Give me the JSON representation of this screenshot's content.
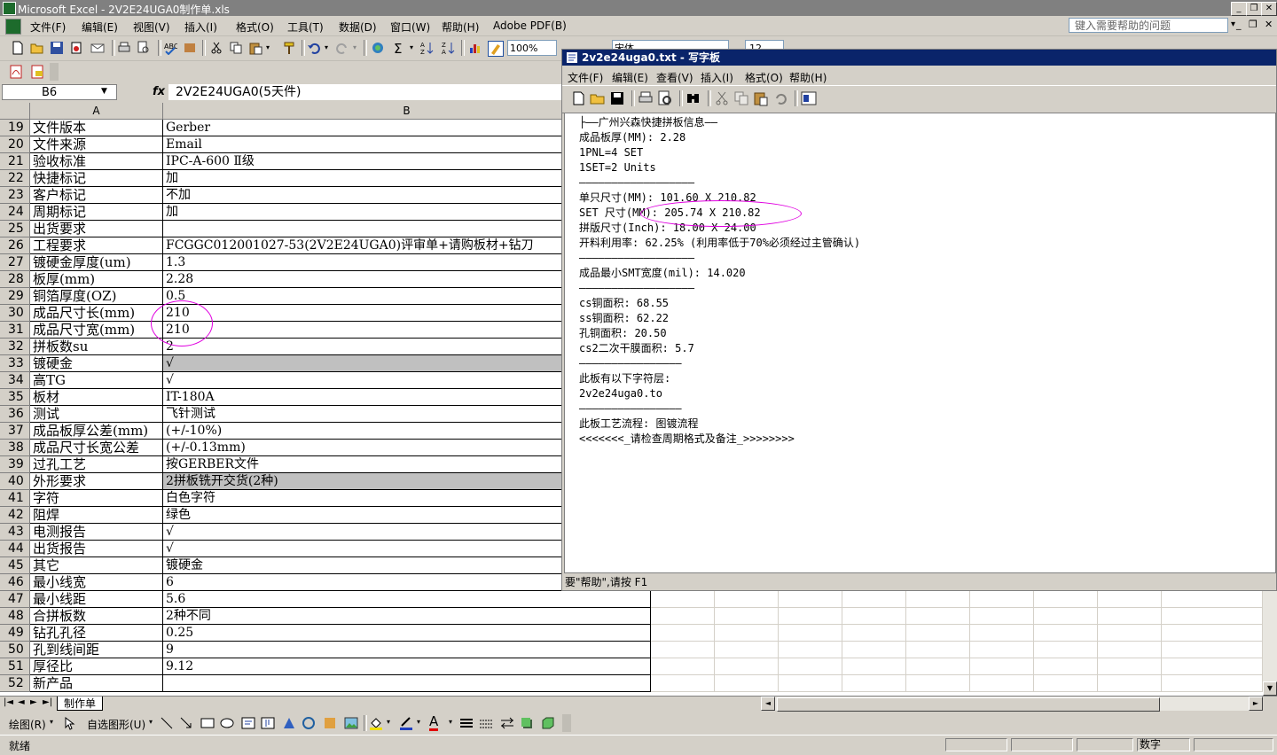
{
  "excel": {
    "title": "Microsoft Excel - 2V2E24UGA0制作单.xls",
    "menu": [
      "文件(F)",
      "编辑(E)",
      "视图(V)",
      "插入(I)",
      "格式(O)",
      "工具(T)",
      "数据(D)",
      "窗口(W)",
      "帮助(H)",
      "Adobe PDF(B)"
    ],
    "help_placeholder": "键入需要帮助的问题",
    "zoom": "100%",
    "font_name": "宋体",
    "font_size": "12",
    "name_box": "B6",
    "fx": "fx",
    "formula": "2V2E24UGA0(5天件)",
    "col_a": "A",
    "col_b": "B",
    "rows": [
      {
        "n": "19",
        "a": "文件版本",
        "b": "Gerber"
      },
      {
        "n": "20",
        "a": "文件来源",
        "b": "Email"
      },
      {
        "n": "21",
        "a": "验收标准",
        "b": "IPC-A-600 Ⅱ级"
      },
      {
        "n": "22",
        "a": "快捷标记",
        "b": "加"
      },
      {
        "n": "23",
        "a": "客户标记",
        "b": "不加"
      },
      {
        "n": "24",
        "a": "周期标记",
        "b": "加"
      },
      {
        "n": "25",
        "a": "出货要求",
        "b": ""
      },
      {
        "n": "26",
        "a": "工程要求",
        "b": "FCGGC012001027-53(2V2E24UGA0)评审单+请购板材+钻刀"
      },
      {
        "n": "27",
        "a": "镀硬金厚度(um)",
        "b": "1.3"
      },
      {
        "n": "28",
        "a": "板厚(mm)",
        "b": "2.28"
      },
      {
        "n": "29",
        "a": "铜箔厚度(OZ)",
        "b": "0.5"
      },
      {
        "n": "30",
        "a": "成品尺寸长(mm)",
        "b": "210"
      },
      {
        "n": "31",
        "a": "成品尺寸宽(mm)",
        "b": "210"
      },
      {
        "n": "32",
        "a": "拼板数su",
        "b": "2"
      },
      {
        "n": "33",
        "a": "镀硬金",
        "b": "√"
      },
      {
        "n": "34",
        "a": "高TG",
        "b": "√"
      },
      {
        "n": "35",
        "a": "板材",
        "b": "IT-180A"
      },
      {
        "n": "36",
        "a": "测试",
        "b": "飞针测试"
      },
      {
        "n": "37",
        "a": "成品板厚公差(mm)",
        "b": "(+/-10%)"
      },
      {
        "n": "38",
        "a": "成品尺寸长宽公差",
        "b": "(+/-0.13mm)"
      },
      {
        "n": "39",
        "a": "过孔工艺",
        "b": "按GERBER文件"
      },
      {
        "n": "40",
        "a": "外形要求",
        "b": "2拼板铣开交货(2种)"
      },
      {
        "n": "41",
        "a": "字符",
        "b": "白色字符"
      },
      {
        "n": "42",
        "a": "阻焊",
        "b": "绿色"
      },
      {
        "n": "43",
        "a": "电测报告",
        "b": "√"
      },
      {
        "n": "44",
        "a": "出货报告",
        "b": "√"
      },
      {
        "n": "45",
        "a": "其它",
        "b": "镀硬金"
      },
      {
        "n": "46",
        "a": "最小线宽",
        "b": "6"
      },
      {
        "n": "47",
        "a": "最小线距",
        "b": "5.6"
      },
      {
        "n": "48",
        "a": "合拼板数",
        "b": "2种不同"
      },
      {
        "n": "49",
        "a": "钻孔孔径",
        "b": "0.25"
      },
      {
        "n": "50",
        "a": "孔到线间距",
        "b": "9"
      },
      {
        "n": "51",
        "a": "厚径比",
        "b": "9.12"
      },
      {
        "n": "52",
        "a": "新产品",
        "b": ""
      }
    ],
    "sheet_tab": "制作单",
    "draw_label": "绘图(R)",
    "autoshape_label": "自选图形(U)",
    "status_ready": "就绪",
    "status_num": "数字"
  },
  "wordpad": {
    "title": "2v2e24uga0.txt - 写字板",
    "menu": [
      "文件(F)",
      "编辑(E)",
      "查看(V)",
      "插入(I)",
      "格式(O)",
      "帮助(H)"
    ],
    "lines": [
      "├——广州兴森快捷拼板信息——",
      "成品板厚(MM): 2.28",
      "1PNL=4 SET",
      "1SET=2 Units",
      "——————————————————",
      "单只尺寸(MM): 101.60 X 210.82",
      "SET 尺寸(MM): 205.74 X 210.82",
      "拼版尺寸(Inch): 18.00 X 24.00",
      "开料利用率: 62.25% (利用率低于70%必须经过主管确认)",
      "——————————————————",
      "成品最小SMT宽度(mil): 14.020",
      "——————————————————",
      "cs铜面积: 68.55",
      "ss铜面积: 62.22",
      "孔铜面积: 20.50",
      "cs2二次干膜面积: 5.7",
      "————————————————",
      "此板有以下字符层:",
      "2v2e24uga0.to",
      "————————————————",
      "此板工艺流程: 图镀流程",
      "<<<<<<<_请检查周期格式及备注_>>>>>>>>"
    ],
    "status": "要\"帮助\",请按 F1"
  }
}
